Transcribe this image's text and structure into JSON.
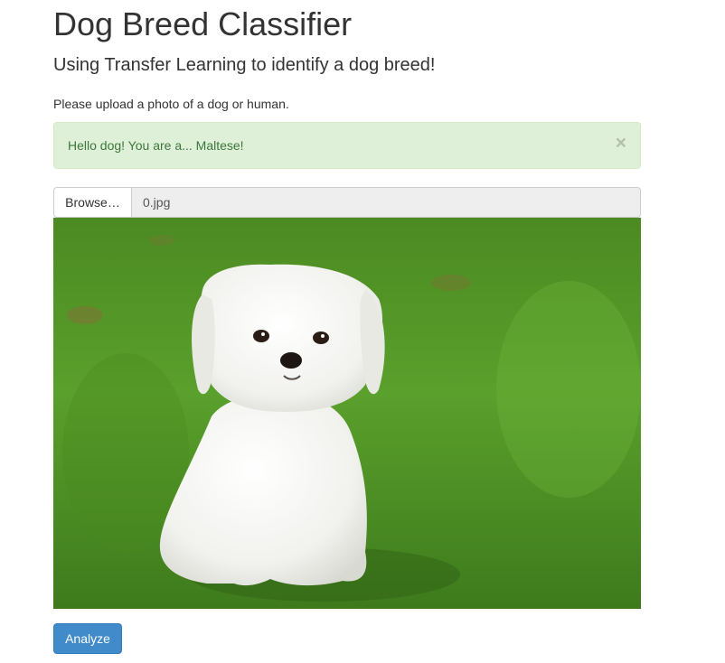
{
  "header": {
    "title": "Dog Breed Classifier",
    "subtitle": "Using Transfer Learning to identify a dog breed!"
  },
  "instructions": "Please upload a photo of a dog or human.",
  "alert": {
    "message": "Hello dog! You are a... Maltese!",
    "close_symbol": "×",
    "type": "success",
    "color": "#3c763d",
    "background": "#dff0d8"
  },
  "file_input": {
    "browse_label": "Browse…",
    "file_name": "0.jpg"
  },
  "preview": {
    "icon": "dog-photo",
    "subject": "white Maltese puppy sitting on grass"
  },
  "actions": {
    "analyze_label": "Analyze",
    "analyze_color": "#428bca"
  }
}
